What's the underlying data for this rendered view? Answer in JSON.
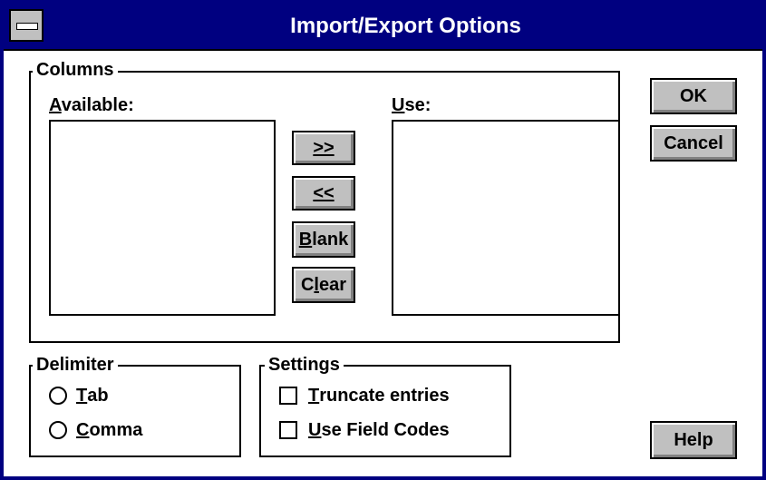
{
  "window": {
    "title": "Import/Export Options"
  },
  "columns": {
    "legend": "Columns",
    "available": {
      "label_prefix": "",
      "label_mnemonic": "A",
      "label_rest": "vailable:"
    },
    "use": {
      "label_prefix": "",
      "label_mnemonic": "U",
      "label_rest": "se:"
    },
    "buttons": {
      "add": {
        "mnemonic": ">>",
        "rest": ""
      },
      "remove": {
        "mnemonic": "<<",
        "rest": ""
      },
      "blank": {
        "mnemonic": "B",
        "rest": "lank"
      },
      "clear": {
        "prefix": "C",
        "mnemonic": "l",
        "rest": "ear"
      }
    }
  },
  "delimiter": {
    "legend": "Delimiter",
    "tab": {
      "mnemonic": "T",
      "rest": "ab"
    },
    "comma": {
      "mnemonic": "C",
      "rest": "omma"
    }
  },
  "settings": {
    "legend": "Settings",
    "truncate": {
      "mnemonic": "T",
      "rest": "runcate entries"
    },
    "field_codes": {
      "mnemonic": "U",
      "rest": "se Field Codes"
    }
  },
  "actions": {
    "ok": "OK",
    "cancel": "Cancel",
    "help": "Help"
  }
}
